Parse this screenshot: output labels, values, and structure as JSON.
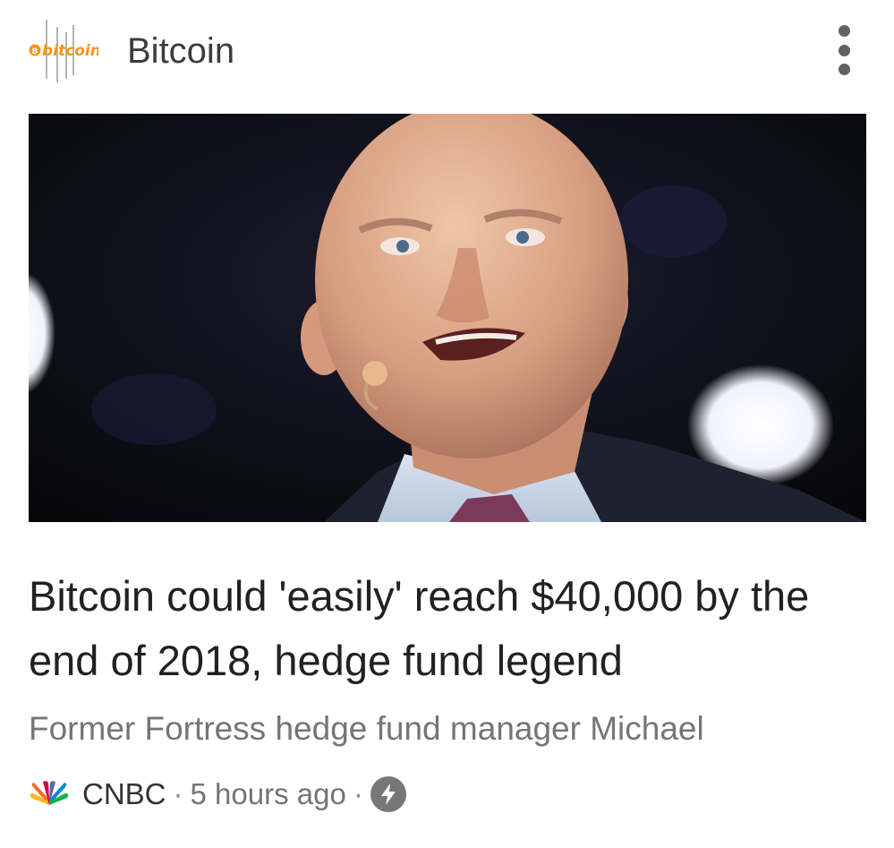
{
  "header": {
    "topic_logo_text": "bitcoin",
    "topic_title": "Bitcoin",
    "menu_icon": "more-vert-icon"
  },
  "hero_image": {
    "subject": "man speaking with headset microphone"
  },
  "article": {
    "headline": "Bitcoin could 'easily' reach $40,000 by the end of 2018, hedge fund legend",
    "snippet": "Former Fortress hedge fund manager Michael",
    "source": "CNBC",
    "separator": "·",
    "age": "5 hours ago",
    "amp_icon": "lightning-bolt-icon",
    "source_icon": "nbc-peacock-icon"
  },
  "colors": {
    "title_text": "#3c3c3c",
    "headline_text": "#212121",
    "secondary_text": "#757575",
    "bitcoin_orange": "#f7931a"
  }
}
